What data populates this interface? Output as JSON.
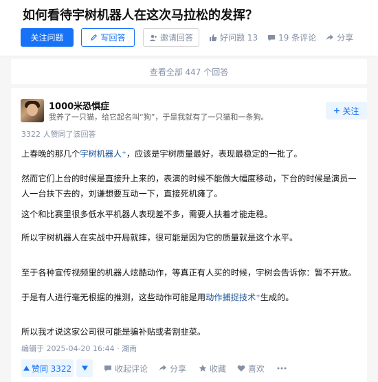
{
  "question": {
    "title": "如何看待宇树机器人在这次马拉松的发挥？",
    "follow_label": "关注问题",
    "write_label": "写回答",
    "invite_label": "邀请回答",
    "good_question": "好问题 13",
    "comments": "19 条评论",
    "share": "分享"
  },
  "view_all": "查看全部 447 个回答",
  "answer": {
    "author": {
      "name": "1000米恐惧症",
      "bio": "我养了一只猫，给它起名叫“狗”，于是我就有了一只猫和一条狗。",
      "follow_label": "关注"
    },
    "upvote_note": "3322 人赞同了该回答",
    "p1_before": "上春晚的那几个",
    "p1_link": "宇树机器人",
    "p1_after": "，应该是宇树质量最好，表现最稳定的一批了。",
    "p2": "然而它们上台的时候是直接升上来的，表演的时候不能做大幅度移动，下台的时候是演员一人一台扶下去的，刘谦想要互动一下，直接死机瘫了。",
    "p3": "这个和比赛里很多低水平机器人表现差不多，需要人扶着才能走稳。",
    "p4": "所以宇树机器人在实战中开局就摔，很可能是因为它的质量就是这个水平。",
    "p5": "至于各种宣传视频里的机器人炫酷动作，等真正有人买的时候，宇树会告诉你：暂不开放。",
    "p6_before": "于是有人进行毫无根据的推测，这些动作可能是用",
    "p6_link": "动作捕捉技术",
    "p6_after": "生成的。",
    "p7": "所以我才说这家公司很可能是骗补贴或者割韭菜。",
    "edit_note": "编辑于 2025-04-20 16:44 · 湖南",
    "vote_label": "赞同 3322",
    "collapse_comments": "收起评论",
    "share": "分享",
    "favorite": "收藏",
    "like": "喜欢"
  },
  "colors": {
    "brand_blue": "#1772f6",
    "light_blue_bg": "#ebf5ff",
    "gray_text": "#8590a6",
    "link": "#175199"
  }
}
